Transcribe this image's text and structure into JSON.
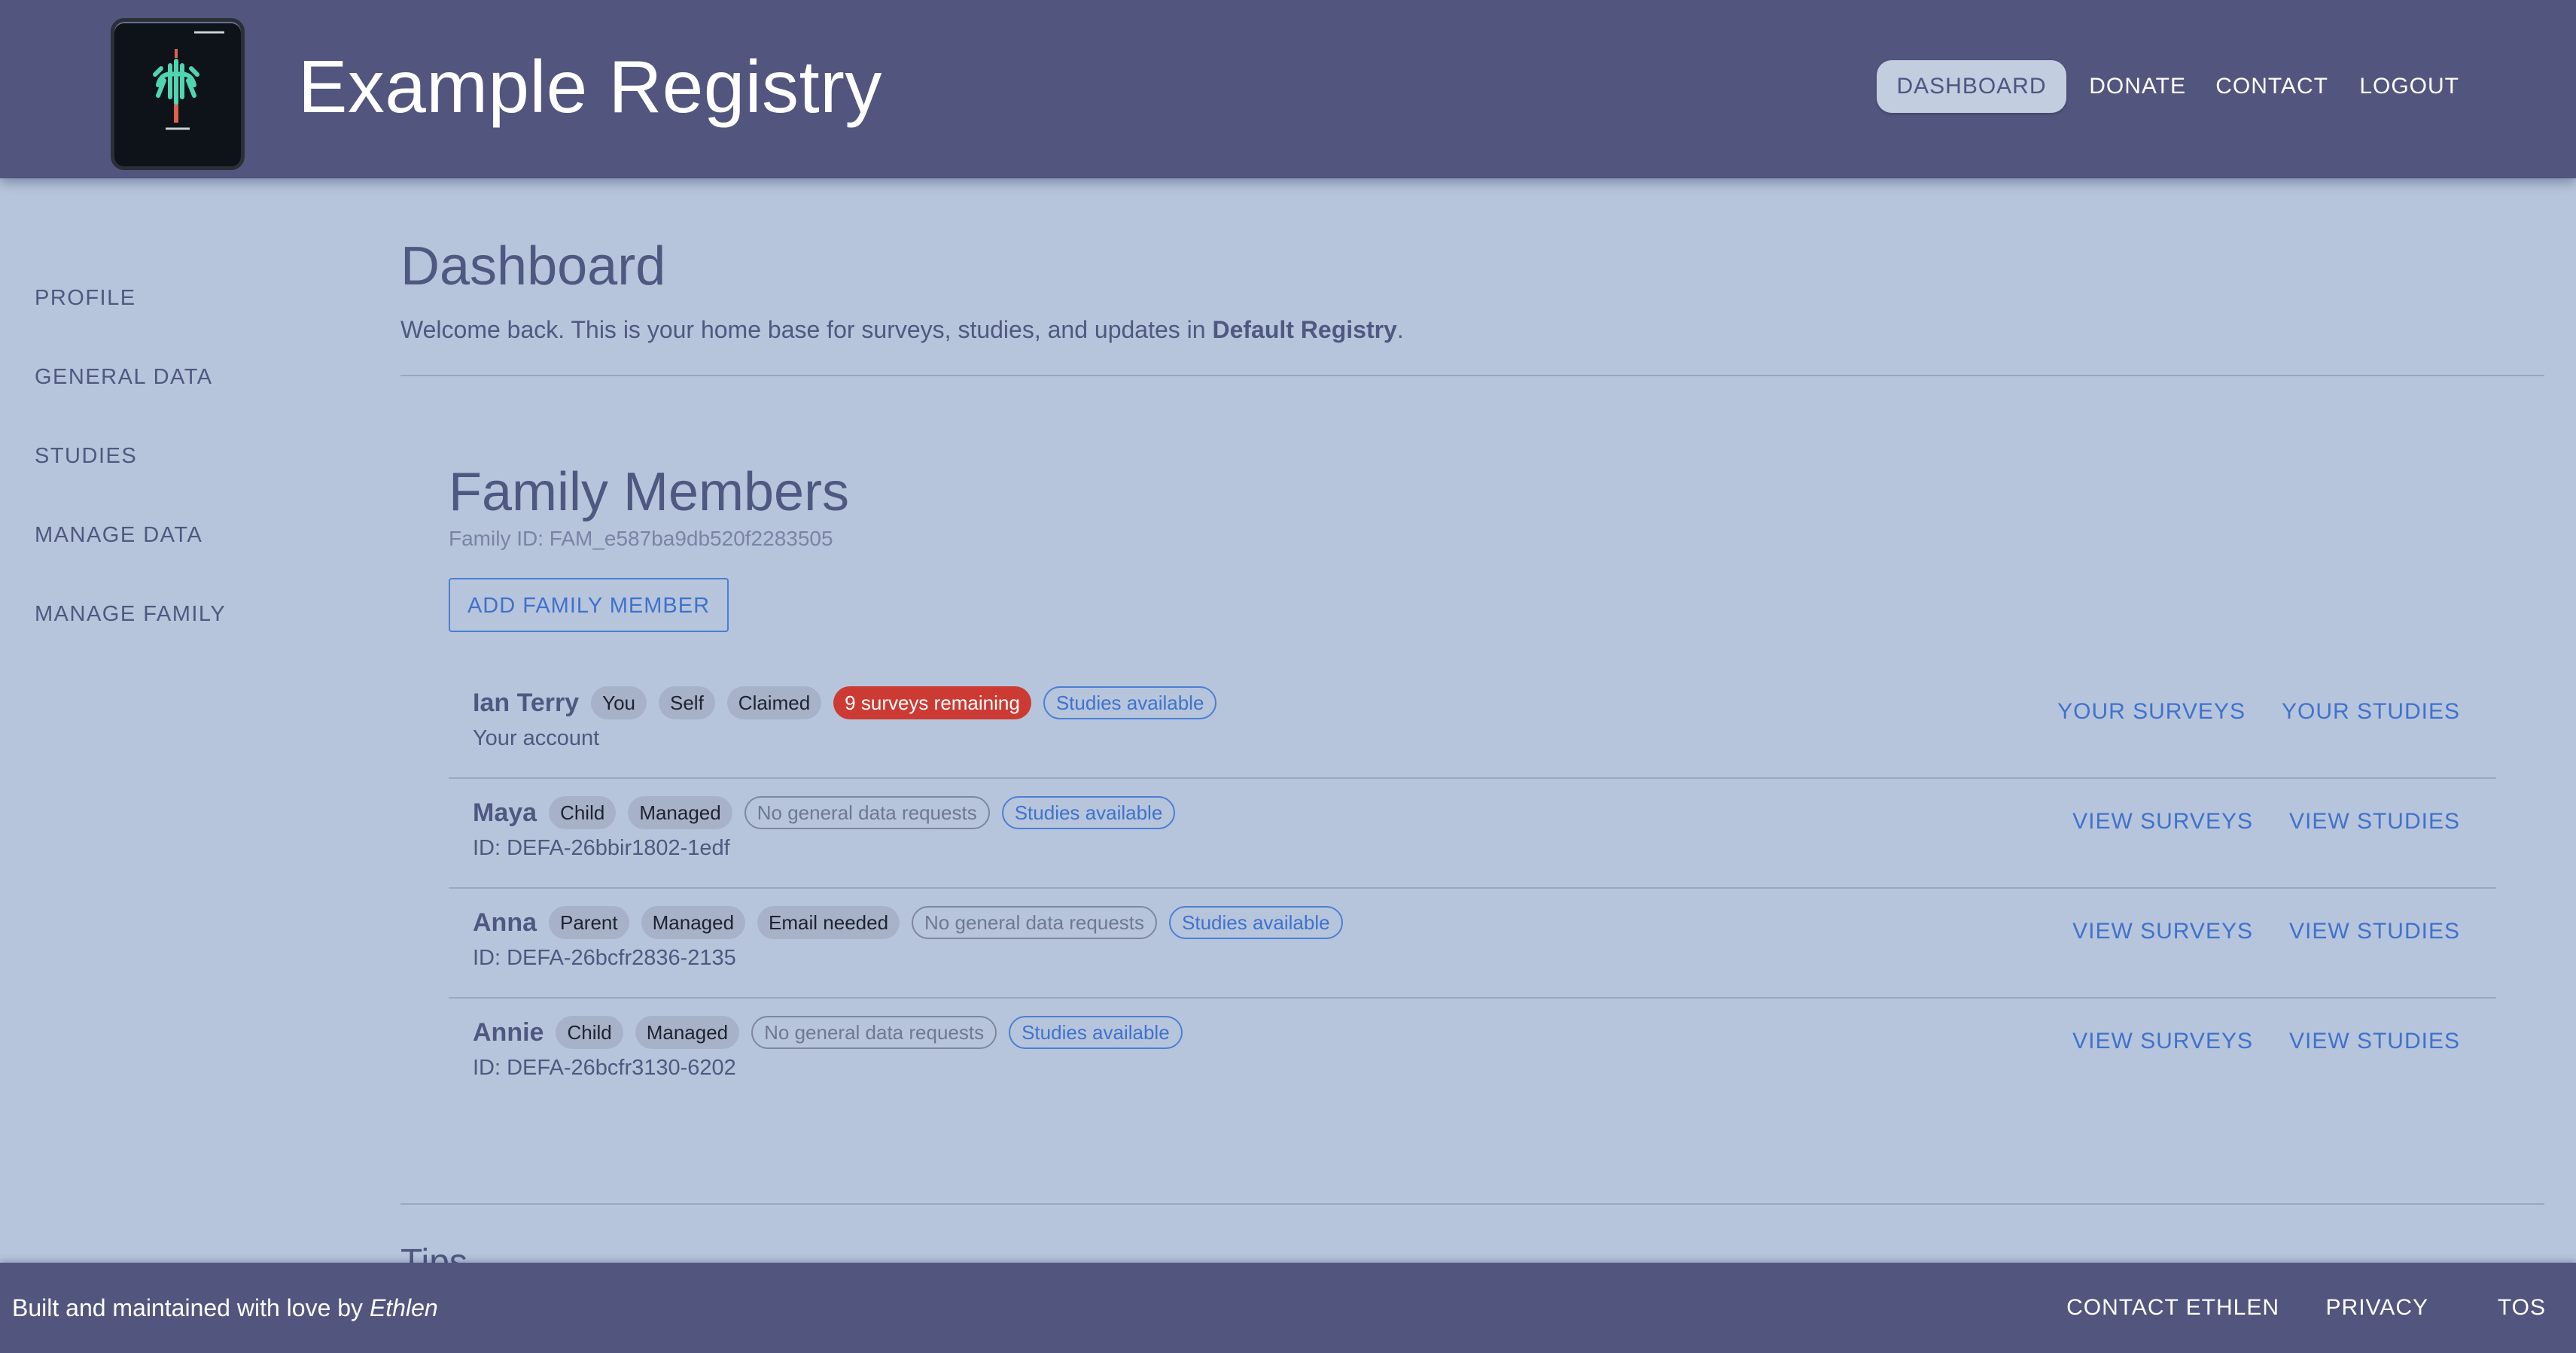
{
  "header": {
    "site_title": "Example Registry",
    "nav": [
      {
        "label": "DASHBOARD",
        "active": true
      },
      {
        "label": "DONATE"
      },
      {
        "label": "CONTACT"
      },
      {
        "label": "LOGOUT"
      }
    ]
  },
  "sidebar": {
    "items": [
      "PROFILE",
      "GENERAL DATA",
      "STUDIES",
      "MANAGE DATA",
      "MANAGE FAMILY"
    ]
  },
  "main": {
    "title": "Dashboard",
    "welcome_prefix": "Welcome back. This is your home base for surveys, studies, and updates in ",
    "welcome_registry": "Default Registry",
    "welcome_suffix": ".",
    "family": {
      "title": "Family Members",
      "family_id": "Family ID: FAM_e587ba9db520f2283505",
      "add_button": "ADD FAMILY MEMBER",
      "members": [
        {
          "name": "Ian Terry",
          "chips": [
            {
              "text": "You",
              "style": "grey"
            },
            {
              "text": "Self",
              "style": "grey"
            },
            {
              "text": "Claimed",
              "style": "grey"
            },
            {
              "text": "9 surveys remaining",
              "style": "red"
            },
            {
              "text": "Studies available",
              "style": "outline-blue"
            }
          ],
          "subtitle": "Your account",
          "actions": [
            "YOUR SURVEYS",
            "YOUR STUDIES"
          ]
        },
        {
          "name": "Maya",
          "chips": [
            {
              "text": "Child",
              "style": "grey"
            },
            {
              "text": "Managed",
              "style": "grey"
            },
            {
              "text": "No general data requests",
              "style": "outline-grey"
            },
            {
              "text": "Studies available",
              "style": "outline-blue"
            }
          ],
          "subtitle": "ID: DEFA-26bbir1802-1edf",
          "actions": [
            "VIEW SURVEYS",
            "VIEW STUDIES"
          ]
        },
        {
          "name": "Anna",
          "chips": [
            {
              "text": "Parent",
              "style": "grey"
            },
            {
              "text": "Managed",
              "style": "grey"
            },
            {
              "text": "Email needed",
              "style": "grey"
            },
            {
              "text": "No general data requests",
              "style": "outline-grey"
            },
            {
              "text": "Studies available",
              "style": "outline-blue"
            }
          ],
          "subtitle": "ID: DEFA-26bcfr2836-2135",
          "actions": [
            "VIEW SURVEYS",
            "VIEW STUDIES"
          ]
        },
        {
          "name": "Annie",
          "chips": [
            {
              "text": "Child",
              "style": "grey"
            },
            {
              "text": "Managed",
              "style": "grey"
            },
            {
              "text": "No general data requests",
              "style": "outline-grey"
            },
            {
              "text": "Studies available",
              "style": "outline-blue"
            }
          ],
          "subtitle": "ID: DEFA-26bcfr3130-6202",
          "actions": [
            "VIEW SURVEYS",
            "VIEW STUDIES"
          ]
        }
      ]
    },
    "tips_heading": "Tips"
  },
  "footer": {
    "credit_prefix": "Built and maintained with love by ",
    "credit_name": "Ethlen",
    "links": [
      "CONTACT ETHLEN",
      "PRIVACY",
      "TOS"
    ]
  },
  "colors": {
    "header_bg": "#52567e",
    "page_bg": "#b7c5dc",
    "accent_blue": "#3f72cc",
    "alert_red": "#cc3b33",
    "text": "#4f5880"
  }
}
